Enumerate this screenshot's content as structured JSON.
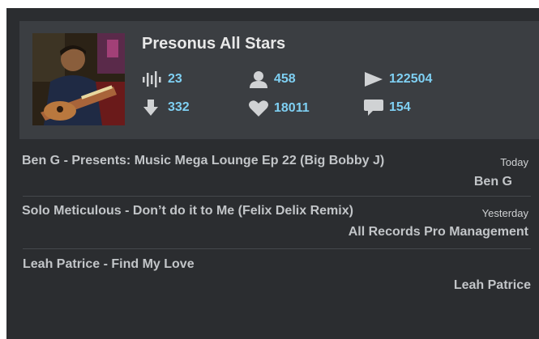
{
  "artist": {
    "name": "Presonus All Stars",
    "photo_icon": "artist-photo"
  },
  "stats": {
    "tracks": {
      "icon": "waveform-icon",
      "value": "23"
    },
    "followers": {
      "icon": "user-icon",
      "value": "458"
    },
    "plays": {
      "icon": "play-icon",
      "value": "122504"
    },
    "downloads": {
      "icon": "download-icon",
      "value": "332"
    },
    "favorites": {
      "icon": "heart-icon",
      "value": "18011"
    },
    "comments": {
      "icon": "comment-icon",
      "value": "154"
    }
  },
  "tracks": [
    {
      "title": "Ben G - Presents: Music Mega Lounge Ep 22 (Big Bobby J)",
      "date": "Today",
      "artist": "Ben G"
    },
    {
      "title": "Solo Meticulous - Don’t do it to Me (Felix Delix Remix)",
      "date": "Yesterday",
      "artist": "All Records Pro Management"
    },
    {
      "title": "Leah  Patrice - Find My Love",
      "date": "",
      "artist": "Leah Patrice"
    }
  ],
  "colors": {
    "background": "#2b2d30",
    "header": "#3b3e42",
    "accent": "#7fd0f3",
    "text": "#c2c5c8",
    "icon": "#d0d2d4"
  }
}
